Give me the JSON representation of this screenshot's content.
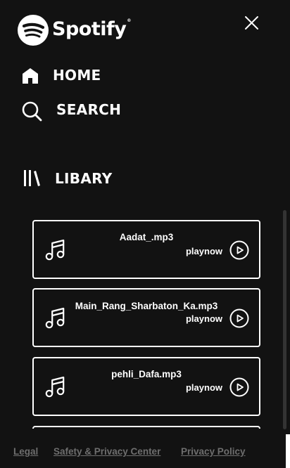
{
  "logo": {
    "text": "Spotify",
    "tm": "®",
    "icon": "spotify-logo"
  },
  "close": {
    "icon": "close-icon"
  },
  "nav": {
    "home": {
      "label": "HOME",
      "icon": "home-icon"
    },
    "search": {
      "label": "SEARCH",
      "icon": "search-icon"
    },
    "library": {
      "label": "LIBARY",
      "icon": "library-icon"
    }
  },
  "songs": [
    {
      "name": "Aadat_.mp3",
      "action": "playnow"
    },
    {
      "name": "Main_Rang_Sharbaton_Ka.mp3",
      "action": "playnow"
    },
    {
      "name": "pehli_Dafa.mp3",
      "action": "playnow"
    }
  ],
  "footer": {
    "legal": "Legal",
    "safety": "Safety & Privacy Center",
    "privacy": "Privacy Policy"
  },
  "colors": {
    "background": "#121212",
    "text": "#ffffff",
    "footer_link": "#6e6e6e"
  }
}
